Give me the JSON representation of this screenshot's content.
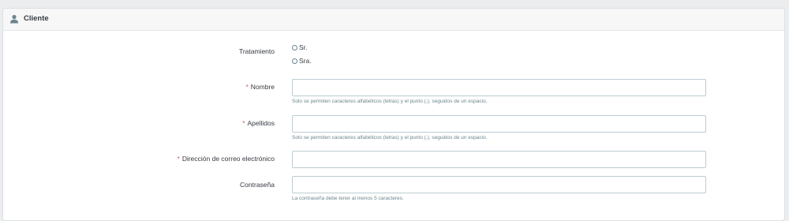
{
  "panel": {
    "title": "Cliente",
    "icon": "user-icon"
  },
  "form": {
    "title_label": "Tratamiento",
    "title_options": [
      "Sr.",
      "Sra."
    ],
    "firstname_label": "Nombre",
    "firstname_value": "",
    "firstname_help": "Solo se permiten caracteres alfabéticos (letras) y el punto (.), seguidos de un espacio.",
    "lastname_label": "Apellidos",
    "lastname_value": "",
    "lastname_help": "Solo se permiten caracteres alfabéticos (letras) y el punto (.), seguidos de un espacio.",
    "email_label": "Dirección de correo electrónico",
    "email_value": "",
    "password_label": "Contraseña",
    "password_value": "",
    "password_help": "La contraseña debe tener al menos 5 caracteres.",
    "required_marker": "*"
  },
  "colors": {
    "required": "#c05c67",
    "text": "#363a41",
    "help": "#6c868e",
    "input_border": "#bbcdd2"
  }
}
